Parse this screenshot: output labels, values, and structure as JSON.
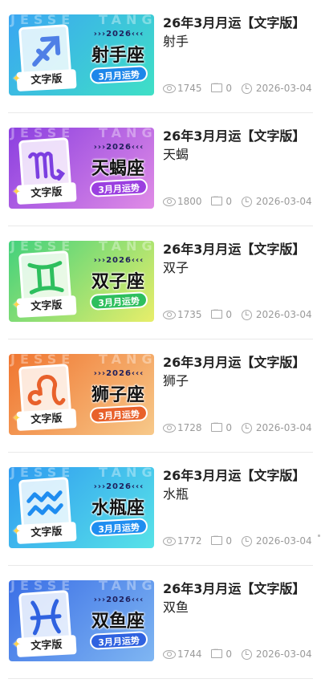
{
  "items": [
    {
      "title": "26年3月月运【文字版】",
      "subtitle": "射手",
      "thumb": {
        "year": "›››2026‹‹‹",
        "sign_name": "射手座",
        "month_label": "3月月运势",
        "text_tag": "文字版",
        "watermark_left": "JESSE",
        "watermark_right": "TANG",
        "glyph_icon": "sagittarius-glyph-icon"
      },
      "views": "1745",
      "comments": "0",
      "date": "2026-03-04",
      "colors": {
        "grad_from": "#3aa6f2",
        "grad_to": "#3fe0c6",
        "pill": "#1e87ea"
      }
    },
    {
      "title": "26年3月月运【文字版】",
      "subtitle": "天蝎",
      "thumb": {
        "year": "›››2026‹‹‹",
        "sign_name": "天蝎座",
        "month_label": "3月月运势",
        "text_tag": "文字版",
        "watermark_left": "JESSE",
        "watermark_right": "TANG",
        "glyph_icon": "scorpio-glyph-icon"
      },
      "views": "1800",
      "comments": "0",
      "date": "2026-03-04",
      "colors": {
        "grad_from": "#8b3fe0",
        "grad_to": "#e08ce6",
        "pill": "#9b3fe0"
      }
    },
    {
      "title": "26年3月月运【文字版】",
      "subtitle": "双子",
      "thumb": {
        "year": "›››2026‹‹‹",
        "sign_name": "双子座",
        "month_label": "3月月运势",
        "text_tag": "文字版",
        "watermark_left": "JESSE",
        "watermark_right": "TANG",
        "glyph_icon": "gemini-glyph-icon"
      },
      "views": "1735",
      "comments": "0",
      "date": "2026-03-04",
      "colors": {
        "grad_from": "#42d17c",
        "grad_to": "#e8ee6a",
        "pill": "#2ebf5e"
      }
    },
    {
      "title": "26年3月月运【文字版】",
      "subtitle": "狮子",
      "thumb": {
        "year": "›››2026‹‹‹",
        "sign_name": "狮子座",
        "month_label": "3月月运势",
        "text_tag": "文字版",
        "watermark_left": "JESSE",
        "watermark_right": "TANG",
        "glyph_icon": "leo-glyph-icon"
      },
      "views": "1728",
      "comments": "0",
      "date": "2026-03-04",
      "colors": {
        "grad_from": "#f0752f",
        "grad_to": "#f7c98a",
        "pill": "#e8612b"
      }
    },
    {
      "title": "26年3月月运【文字版】",
      "subtitle": "水瓶",
      "thumb": {
        "year": "›››2026‹‹‹",
        "sign_name": "水瓶座",
        "month_label": "3月月运势",
        "text_tag": "文字版",
        "watermark_left": "JESSE",
        "watermark_right": "TANG",
        "glyph_icon": "aquarius-glyph-icon"
      },
      "views": "1772",
      "comments": "0",
      "date": "2026-03-04",
      "colors": {
        "grad_from": "#2f9bf0",
        "grad_to": "#58e3e8",
        "pill": "#1f8df0"
      }
    },
    {
      "title": "26年3月月运【文字版】",
      "subtitle": "双鱼",
      "thumb": {
        "year": "›››2026‹‹‹",
        "sign_name": "双鱼座",
        "month_label": "3月月运势",
        "text_tag": "文字版",
        "watermark_left": "JESSE",
        "watermark_right": "TANG",
        "glyph_icon": "pisces-glyph-icon"
      },
      "views": "1744",
      "comments": "0",
      "date": "2026-03-04",
      "colors": {
        "grad_from": "#3b6fe6",
        "grad_to": "#7fb6f2",
        "pill": "#2f62e0"
      }
    }
  ],
  "icons": {
    "views": "eye-icon",
    "comments": "comment-icon",
    "date": "clock-icon",
    "sparkle": "sparkle-icon"
  }
}
